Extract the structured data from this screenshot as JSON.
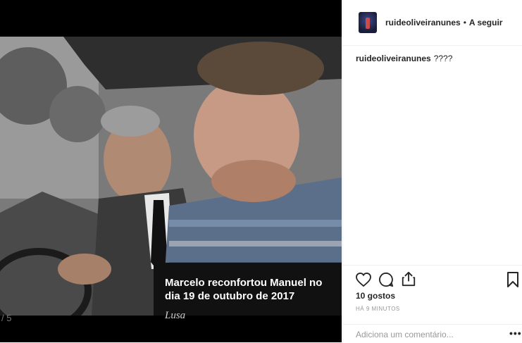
{
  "post": {
    "slide_counter": "/ 5",
    "caption": "Marcelo reconfortou Manuel no dia 19 de outubro de 2017",
    "credit": "Lusa"
  },
  "header": {
    "username": "ruideoliveiranunes",
    "separator": "•",
    "follow_label": "A seguir"
  },
  "comment": {
    "username": "ruideoliveiranunes",
    "text": "????"
  },
  "actions": {
    "icons": [
      "heart-icon",
      "comment-icon",
      "share-icon",
      "bookmark-icon"
    ],
    "likes": "10 gostos",
    "time": "HÁ 9 MINUTOS"
  },
  "add_comment": {
    "placeholder": "Adiciona um comentário...",
    "more_label": "•••"
  }
}
